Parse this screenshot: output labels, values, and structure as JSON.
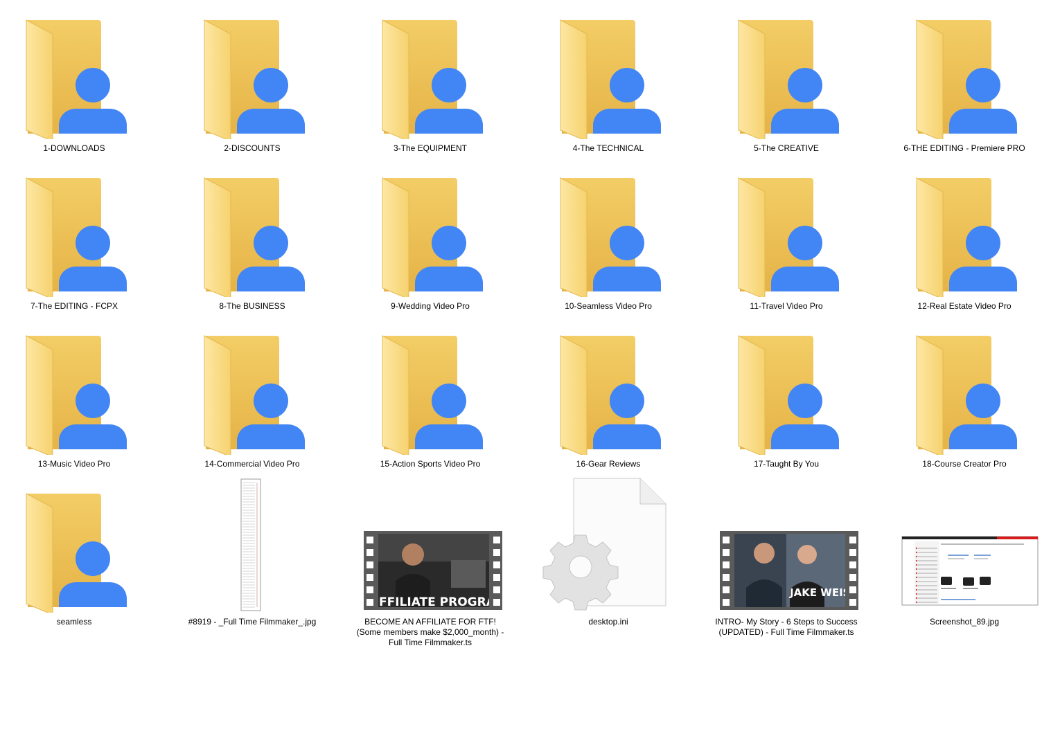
{
  "items": [
    {
      "type": "folder",
      "name": "1-DOWNLOADS"
    },
    {
      "type": "folder",
      "name": "2-DISCOUNTS"
    },
    {
      "type": "folder",
      "name": "3-The EQUIPMENT"
    },
    {
      "type": "folder",
      "name": "4-The TECHNICAL"
    },
    {
      "type": "folder",
      "name": "5-The CREATIVE"
    },
    {
      "type": "folder",
      "name": "6-THE EDITING - Premiere PRO"
    },
    {
      "type": "folder",
      "name": "7-The EDITING - FCPX"
    },
    {
      "type": "folder",
      "name": "8-The BUSINESS"
    },
    {
      "type": "folder",
      "name": "9-Wedding Video Pro"
    },
    {
      "type": "folder",
      "name": "10-Seamless Video Pro"
    },
    {
      "type": "folder",
      "name": "11-Travel Video Pro"
    },
    {
      "type": "folder",
      "name": "12-Real Estate Video Pro"
    },
    {
      "type": "folder",
      "name": "13-Music Video Pro"
    },
    {
      "type": "folder",
      "name": "14-Commercial Video Pro"
    },
    {
      "type": "folder",
      "name": "15-Action Sports Video Pro"
    },
    {
      "type": "folder",
      "name": "16-Gear Reviews"
    },
    {
      "type": "folder",
      "name": "17-Taught By You"
    },
    {
      "type": "folder",
      "name": "18-Course Creator Pro"
    },
    {
      "type": "folder",
      "name": "seamless"
    },
    {
      "type": "image-tall",
      "name": "#8919 - _Full Time Filmmaker_.jpg"
    },
    {
      "type": "video",
      "name": "BECOME AN AFFILIATE FOR FTF! (Some members make $2,000_month) - Full Time Filmmaker.ts",
      "thumb_text": "FFILIATE PROGRA"
    },
    {
      "type": "settings-file",
      "name": "desktop.ini"
    },
    {
      "type": "video",
      "name": "INTRO- My Story - 6 Steps to Success (UPDATED) - Full Time Filmmaker.ts",
      "thumb_text": "JAKE WEISL"
    },
    {
      "type": "screenshot",
      "name": "Screenshot_89.jpg"
    }
  ],
  "colors": {
    "folder_back": "#e8b84a",
    "folder_front": "#f9d67a",
    "person_blue": "#4285f4"
  }
}
